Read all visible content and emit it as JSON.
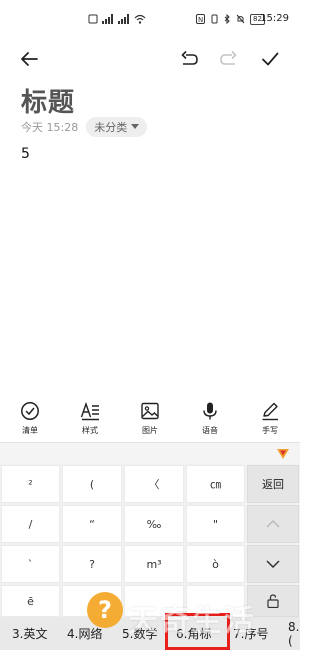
{
  "status_bar": {
    "time": "15:29",
    "battery": "82",
    "network_a": "⁴⁶",
    "network_b": "ᴴᴰ"
  },
  "toolbar": {
    "back_icon": "arrow-left-icon",
    "undo_icon": "undo-icon",
    "redo_icon": "redo-icon",
    "done_icon": "checkmark-icon"
  },
  "note": {
    "title": "标题",
    "date": "今天 15:28",
    "category": "未分类",
    "body": "5"
  },
  "format_bar": {
    "items": [
      {
        "label": "清单",
        "icon": "checklist-icon"
      },
      {
        "label": "样式",
        "icon": "text-style-icon"
      },
      {
        "label": "图片",
        "icon": "image-icon"
      },
      {
        "label": "语音",
        "icon": "microphone-icon"
      },
      {
        "label": "手写",
        "icon": "pen-icon"
      }
    ]
  },
  "keyboard": {
    "keys": [
      [
        "²",
        "(",
        "〈",
        "㎝"
      ],
      [
        "/",
        "“",
        "‰",
        "\""
      ],
      [
        "`",
        "?",
        "m³",
        "ò"
      ],
      [
        "ē",
        "",
        "",
        ""
      ]
    ],
    "side": {
      "back": "返回",
      "up_icon": "chevron-up-icon",
      "down_icon": "chevron-down-icon",
      "lock_icon": "lock-icon"
    },
    "categories": [
      "3.英文",
      "4.网络",
      "5.数学",
      "6.角标",
      "7.序号",
      "8.("
    ],
    "selected_category": "6.角标"
  },
  "watermark": {
    "badge": "?",
    "text": "天奇生活"
  },
  "colors": {
    "highlight": "#e8201c",
    "watermark_badge": "#f5a623"
  }
}
